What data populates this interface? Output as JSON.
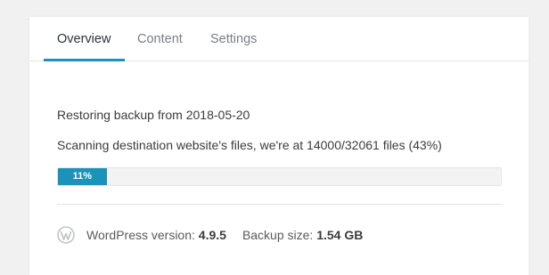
{
  "tabs": [
    {
      "label": "Overview",
      "active": true
    },
    {
      "label": "Content",
      "active": false
    },
    {
      "label": "Settings",
      "active": false
    }
  ],
  "restore": {
    "title": "Restoring backup from 2018-05-20",
    "status": "Scanning destination website's files, we're at 14000/32061 files (43%)",
    "progress_percent": 11,
    "progress_label": "11%"
  },
  "footer": {
    "icon": "wordpress-icon",
    "wp_version_label": "WordPress version:",
    "wp_version_value": "4.9.5",
    "backup_size_label": "Backup size:",
    "backup_size_value": "1.54 GB"
  },
  "colors": {
    "accent": "#1b92b8",
    "background": "#f1f1f1",
    "card": "#ffffff"
  }
}
